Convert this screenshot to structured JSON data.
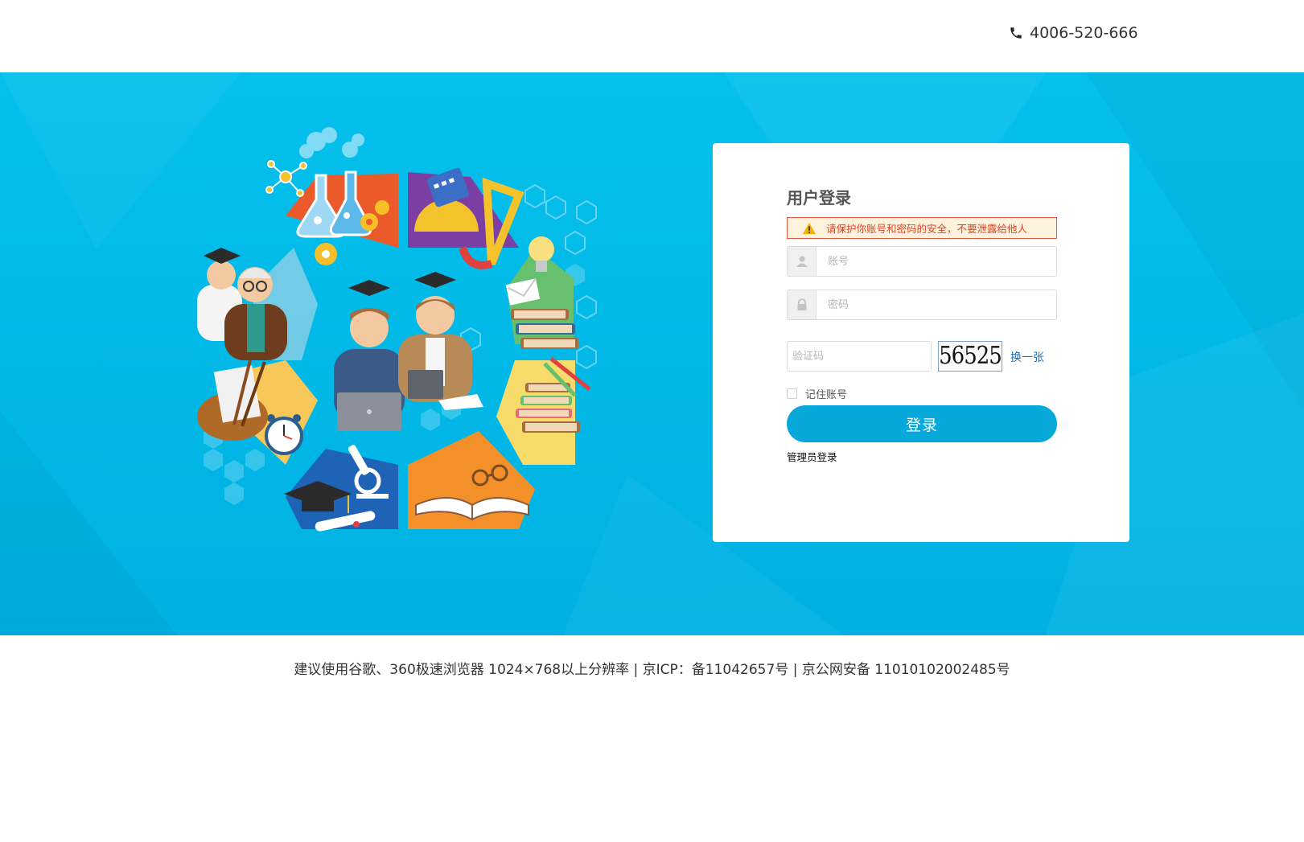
{
  "header": {
    "phone": "4006-520-666",
    "phone_icon": "phone-icon"
  },
  "login": {
    "title": "用户登录",
    "warning": "请保护你账号和密码的安全，不要泄露给他人",
    "account_placeholder": "账号",
    "password_placeholder": "密码",
    "captcha_placeholder": "验证码",
    "captcha_code": "56525",
    "refresh_label": "换一张",
    "remember_label": "记住账号",
    "submit_label": "登录",
    "admin_label": "管理员登录"
  },
  "footer": {
    "text": "建议使用谷歌、360极速浏览器 1024×768以上分辨率 | 京ICP：备11042657号 | 京公网安备 11010102002485号"
  },
  "colors": {
    "banner": "#00b7e6",
    "button": "#06a8da",
    "warning_border": "#e2573e",
    "warning_text": "#e0402a",
    "link": "#1f6fb5"
  }
}
